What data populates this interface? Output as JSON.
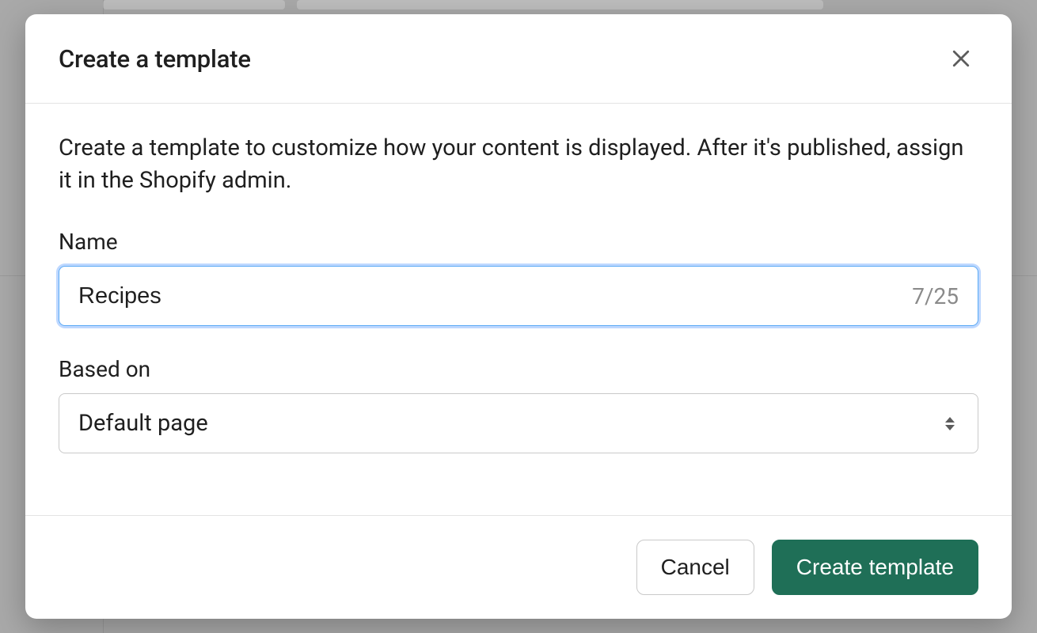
{
  "modal": {
    "title": "Create a template",
    "description": "Create a template to customize how your content is displayed. After it's published, assign it in the Shopify admin."
  },
  "fields": {
    "name": {
      "label": "Name",
      "value": "Recipes",
      "char_count": "7/25"
    },
    "based_on": {
      "label": "Based on",
      "selected": "Default page"
    }
  },
  "buttons": {
    "cancel": "Cancel",
    "create": "Create template"
  }
}
